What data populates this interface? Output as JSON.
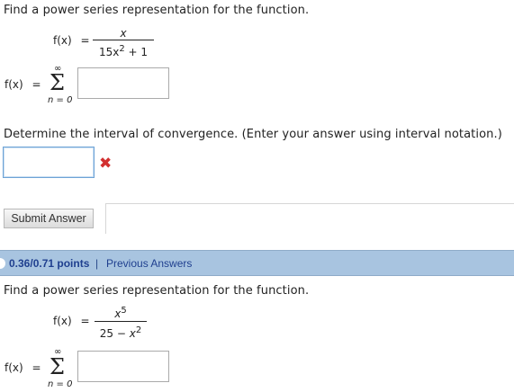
{
  "q1": {
    "prompt": "Find a power series representation for the function.",
    "fx_label": "f(x)",
    "equals": "=",
    "numerator": "x",
    "denominator_base": "15x",
    "denominator_exp": "2",
    "denominator_rest": "+ 1",
    "sum_label": "f(x)",
    "sum_upper": "∞",
    "sum_lower": "n = 0",
    "sigma": "Σ",
    "series_value": "",
    "interval_prompt": "Determine the interval of convergence. (Enter your answer using interval notation.)",
    "interval_value": "",
    "submit_label": "Submit Answer"
  },
  "q2_header": {
    "points": "0.36/0.71 points",
    "separator": "|",
    "previous": "Previous Answers"
  },
  "q2": {
    "prompt": "Find a power series representation for the function.",
    "fx_label": "f(x)",
    "equals": "=",
    "numerator_base": "x",
    "numerator_exp": "5",
    "denominator": "25 −",
    "denominator_var": "x",
    "denominator_exp": "2",
    "sum_label": "f(x)",
    "sum_upper": "∞",
    "sum_lower": "n = 0",
    "sigma": "Σ",
    "series_value": ""
  },
  "colors": {
    "header_bar": "#a8c4e0",
    "link": "#1f3f8f",
    "error": "#d23030"
  },
  "icons": {
    "error": "close-icon"
  }
}
